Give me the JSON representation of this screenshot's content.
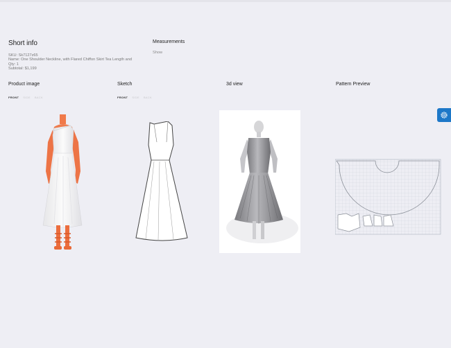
{
  "short_info": {
    "title": "Short info",
    "sku": "SKU: Sk7127z65",
    "name": "Name: One Shoulder Neckline, with Flared Chiffon Skirt Tea Length and",
    "qty": "Qty: 1",
    "subtotal": "Subtotal: $1,199"
  },
  "measurements": {
    "title": "Measurements",
    "show_label": "Show"
  },
  "sections": {
    "product_image": {
      "title": "Product image",
      "views": [
        "FRONT",
        "SIDE",
        "BACK"
      ]
    },
    "sketch": {
      "title": "Sketch",
      "views": [
        "FRONT",
        "SIDE",
        "BACK"
      ]
    },
    "view_3d": {
      "title": "3d view"
    },
    "pattern_preview": {
      "title": "Pattern Preview"
    }
  },
  "colors": {
    "background": "#eeeef4",
    "accent": "#1d78c8",
    "skin": "#f07a4a",
    "dress": "#f4f4f4"
  },
  "icons": {
    "settings": "gear-icon"
  }
}
